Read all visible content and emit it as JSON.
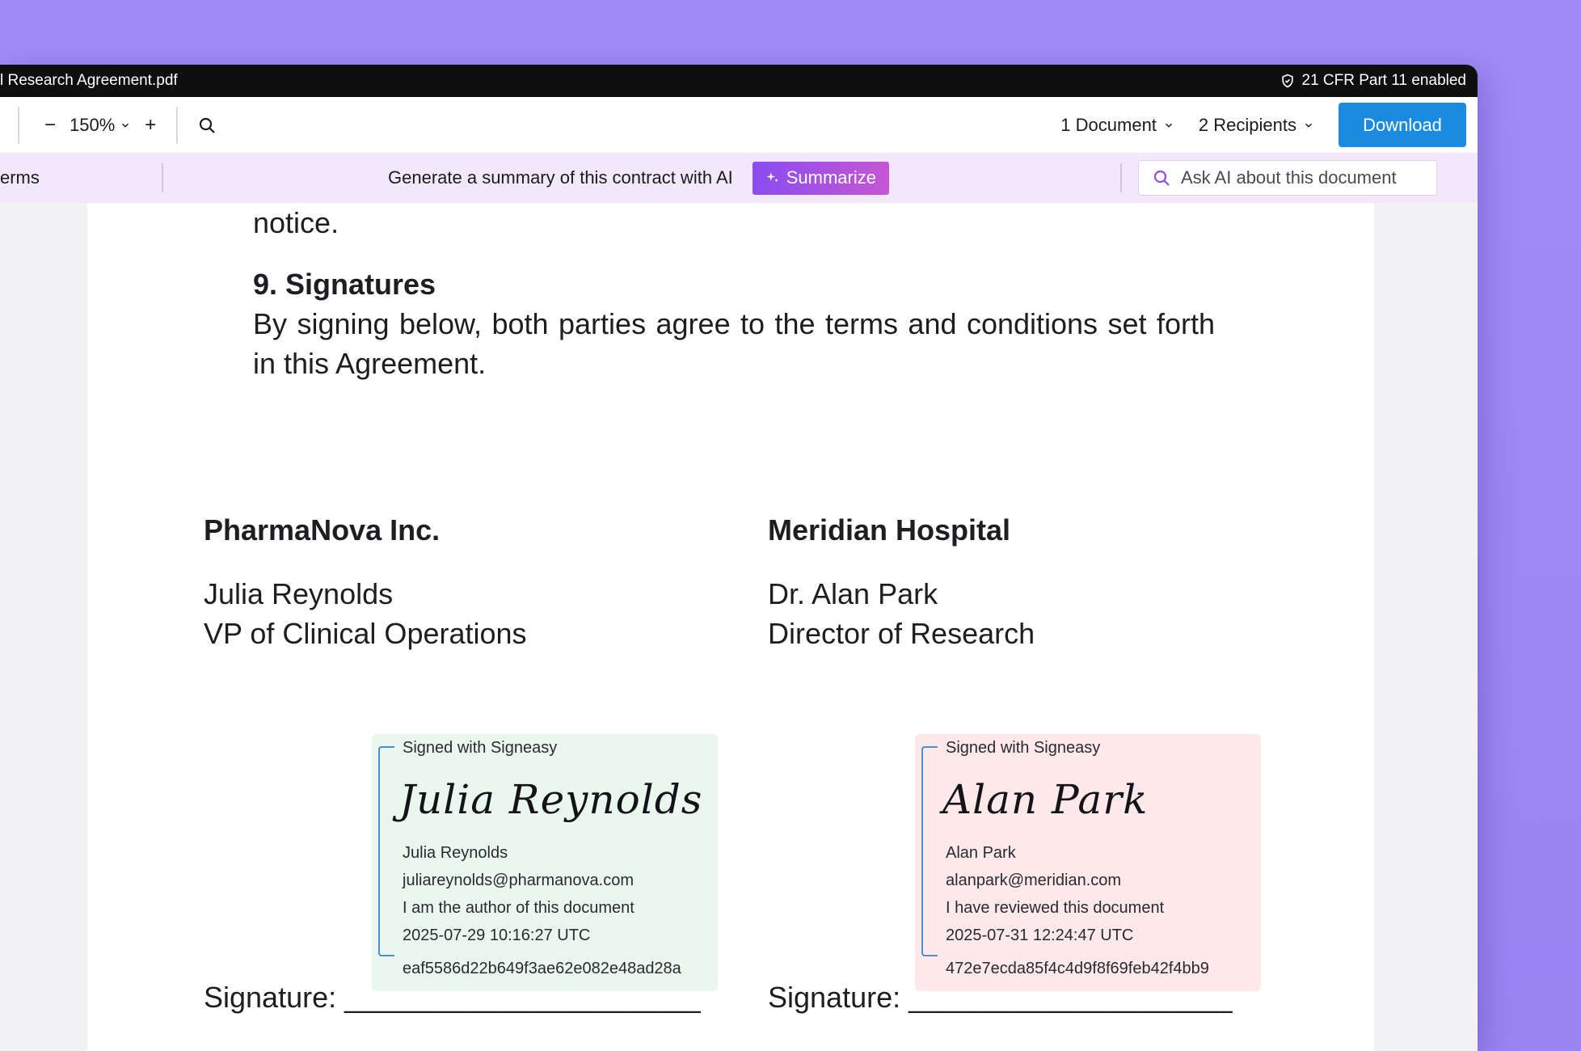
{
  "window": {
    "filename": "l Research Agreement.pdf",
    "compliance_badge": "21 CFR Part 11 enabled"
  },
  "toolbar": {
    "zoom_out": "−",
    "zoom_value": "150%",
    "zoom_in": "+",
    "documents": "1 Document",
    "recipients": "2 Recipients",
    "download": "Download"
  },
  "aibar": {
    "tab_terms": "erms",
    "promo_text": "Generate a summary of this contract with AI",
    "summarize": "Summarize",
    "ask_placeholder": "Ask AI about this document"
  },
  "document": {
    "notice": "notice.",
    "section_title": "9. Signatures",
    "section_body": "By signing below, both parties agree to the terms and conditions set forth in this Agreement.",
    "parties": [
      {
        "company": "PharmaNova Inc.",
        "person": "Julia Reynolds",
        "role": "VP of Clinical Operations",
        "signature_label": "Signature: ______________________",
        "sig": {
          "signed_with": "Signed with Signeasy",
          "script": "Julia Reynolds",
          "name": "Julia Reynolds",
          "email": "juliareynolds@pharmanova.com",
          "reason": "I am the author of this document",
          "timestamp": "2025-07-29 10:16:27 UTC",
          "hash": "eaf5586d22b649f3ae62e082e48ad28a",
          "bg_color": "#e9f7ef"
        }
      },
      {
        "company": "Meridian Hospital",
        "person": "Dr. Alan Park",
        "role": "Director of Research",
        "signature_label": "Signature: ____________________",
        "sig": {
          "signed_with": "Signed with Signeasy",
          "script": "Alan Park",
          "name": "Alan Park",
          "email": "alanpark@meridian.com",
          "reason": "I have reviewed this document",
          "timestamp": "2025-07-31 12:24:47 UTC",
          "hash": "472e7ecda85f4c4d9f8f69feb42f4bb9",
          "bg_color": "#fde8ea"
        }
      }
    ]
  },
  "colors": {
    "background": "#a08cf8",
    "accent_blue": "#1a8be0",
    "ai_gradient_start": "#8b4cf0",
    "ai_gradient_end": "#c557d3"
  }
}
